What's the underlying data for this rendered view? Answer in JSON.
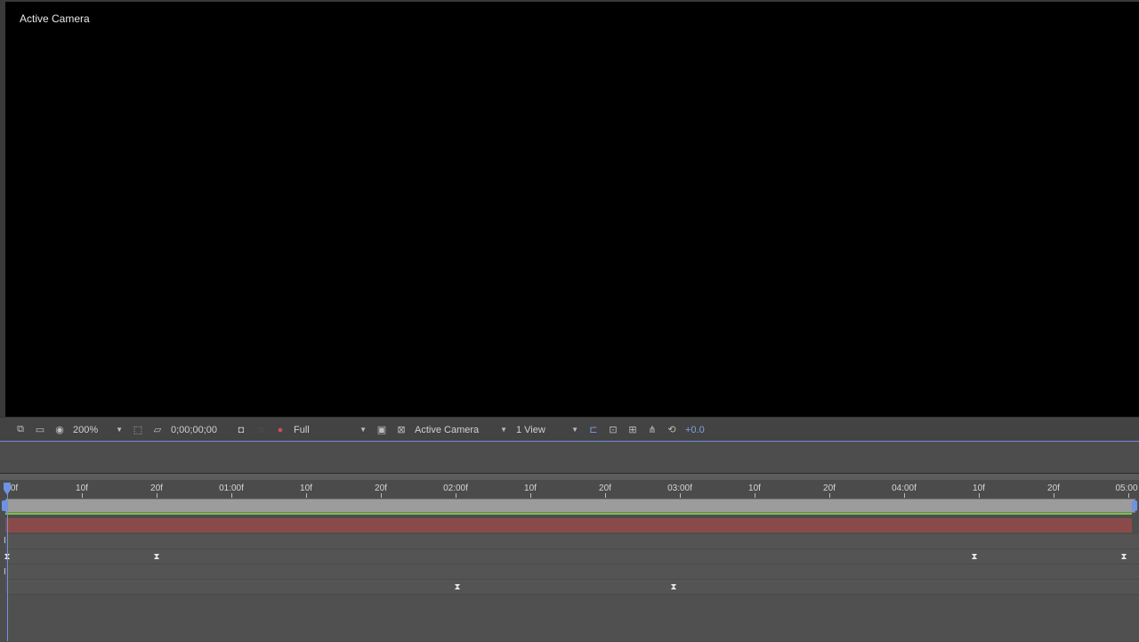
{
  "viewer": {
    "label": "Active Camera"
  },
  "toolbar": {
    "zoom": "200%",
    "timecode": "0;00;00;00",
    "resolution": "Full",
    "camera": "Active Camera",
    "view_layout": "1 View",
    "exposure": "+0.0",
    "icons": [
      "always-preview-icon",
      "monitor-icon",
      "mask-visibility-icon",
      "region-of-interest-icon",
      "transparency-grid-icon",
      "snapshot-camera-icon",
      "show-snapshot-icon",
      "color-channels-icon",
      "fast-preview-icon",
      "toggle-pixel-aspect-icon",
      "timeline-icon",
      "comp-flowchart-icon",
      "reset-exposure-icon"
    ]
  },
  "timeline": {
    "ticks": [
      "0f",
      "10f",
      "20f",
      "01:00f",
      "10f",
      "20f",
      "02:00f",
      "10f",
      "20f",
      "03:00f",
      "10f",
      "20f",
      "04:00f",
      "10f",
      "20f",
      "05:00"
    ]
  },
  "colors": {
    "accent_blue": "#6f93e0",
    "layer_red": "#8b4a4a",
    "green_line": "#7cc241"
  }
}
